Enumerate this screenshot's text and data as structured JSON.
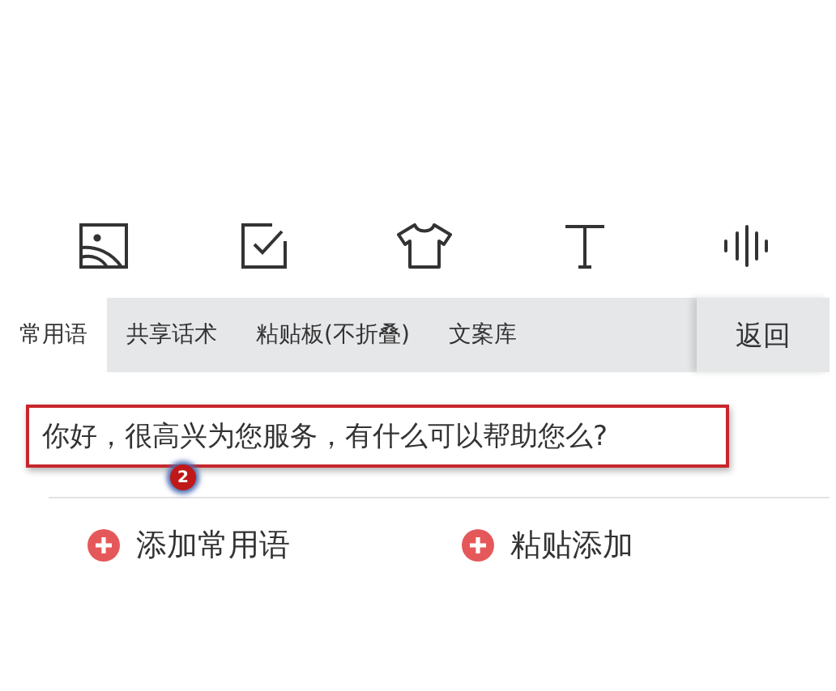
{
  "toolbar": [
    {
      "kind": "image"
    },
    {
      "kind": "checkbox"
    },
    {
      "kind": "shirt"
    },
    {
      "kind": "text"
    },
    {
      "kind": "voice"
    }
  ],
  "tabs": [
    {
      "label": "常用语",
      "selected": true
    },
    {
      "label": "共享话术",
      "selected": false
    },
    {
      "label": "粘贴板(不折叠)",
      "selected": false
    },
    {
      "label": "文案库",
      "selected": false
    }
  ],
  "back_button": "返回",
  "phrases": [
    {
      "text": "你好，很高兴为您服务，有什么可以帮助您么?",
      "highlighted": true,
      "badge": "2"
    }
  ],
  "actions": [
    {
      "label": "添加常用语"
    },
    {
      "label": "粘贴添加"
    }
  ]
}
